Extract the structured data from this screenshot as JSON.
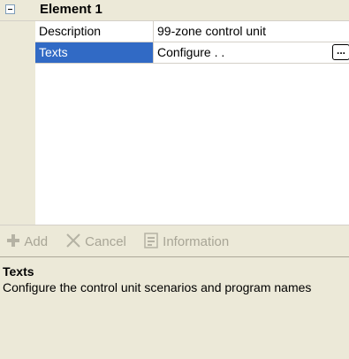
{
  "grid": {
    "category": {
      "title": "Element 1",
      "expanded": true
    },
    "properties": [
      {
        "name": "Description",
        "value": "99-zone control unit"
      },
      {
        "name": "Texts",
        "value": "Configure . .",
        "selected": true,
        "has_ellipsis": true
      }
    ],
    "ellipsis_label": "..."
  },
  "toolbar": {
    "add_label": "Add",
    "add_icon": "plus-icon",
    "cancel_label": "Cancel",
    "cancel_icon": "x-icon",
    "info_label": "Information",
    "info_icon": "document-icon",
    "state": "disabled"
  },
  "help": {
    "title": "Texts",
    "description": "Configure the control unit scenarios and program names"
  },
  "colors": {
    "selection": "#316ac5",
    "panel": "#ece9d8",
    "disabled_text": "#a8a596"
  }
}
